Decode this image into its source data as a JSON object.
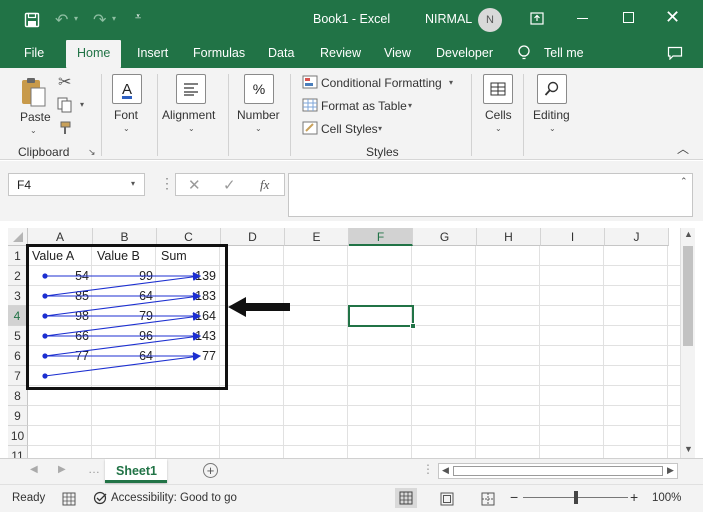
{
  "titlebar": {
    "doc_title": "Book1 - Excel",
    "user_name": "NIRMAL",
    "user_initial": "N",
    "accent": "#217346"
  },
  "tabs": [
    {
      "label": "File"
    },
    {
      "label": "Home"
    },
    {
      "label": "Insert"
    },
    {
      "label": "Formulas"
    },
    {
      "label": "Data"
    },
    {
      "label": "Review"
    },
    {
      "label": "View"
    },
    {
      "label": "Developer"
    },
    {
      "label": "Tell me"
    }
  ],
  "ribbon": {
    "paste": "Paste",
    "clipboard": "Clipboard",
    "font": "Font",
    "alignment": "Alignment",
    "number": "Number",
    "number_symbol": "%",
    "conditional_formatting": "Conditional Formatting",
    "format_as_table": "Format as Table",
    "cell_styles": "Cell Styles",
    "styles": "Styles",
    "cells": "Cells",
    "editing": "Editing"
  },
  "formula_bar": {
    "name_box": "F4",
    "fx": "fx",
    "formula": ""
  },
  "grid": {
    "columns": [
      "A",
      "B",
      "C",
      "D",
      "E",
      "F",
      "G",
      "H",
      "I",
      "J"
    ],
    "rows": [
      "1",
      "2",
      "3",
      "4",
      "5",
      "6",
      "7",
      "8",
      "9",
      "10",
      "11"
    ],
    "selected_cell": "F4",
    "header_row": [
      "Value A",
      "Value B",
      "Sum"
    ],
    "data_rows": [
      [
        "54",
        "99",
        "139"
      ],
      [
        "85",
        "64",
        "183"
      ],
      [
        "98",
        "79",
        "164"
      ],
      [
        "66",
        "96",
        "143"
      ],
      [
        "77",
        "64",
        "77"
      ]
    ]
  },
  "sheet_tabs": [
    {
      "label": "Sheet1"
    }
  ],
  "status": {
    "ready": "Ready",
    "accessibility": "Accessibility: Good to go",
    "zoom": "100%"
  }
}
